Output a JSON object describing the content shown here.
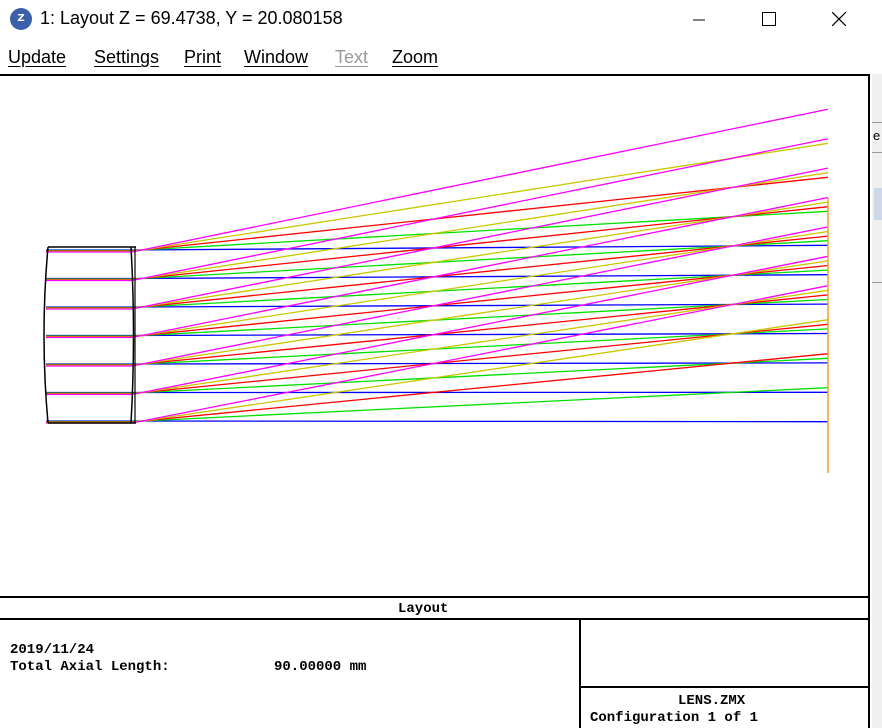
{
  "window": {
    "title": "1: Layout Z = 69.4738, Y = 20.080158",
    "icon": "zemax-app-icon",
    "controls": [
      "minimize-icon",
      "maximize-icon",
      "close-icon"
    ]
  },
  "menu": {
    "items": [
      {
        "label": "Update",
        "enabled": true
      },
      {
        "label": "Settings",
        "enabled": true
      },
      {
        "label": "Print",
        "enabled": true
      },
      {
        "label": "Window",
        "enabled": true
      },
      {
        "label": "Text",
        "enabled": false
      },
      {
        "label": "Zoom",
        "enabled": true
      }
    ]
  },
  "side_panel": {
    "visible_char": "e"
  },
  "footer": {
    "title": "Layout",
    "date": "2019/11/24",
    "total_axial_length_label": "Total Axial Length:",
    "total_axial_length_value": "90.00000 mm",
    "file_name": "LENS.ZMX",
    "configuration": "Configuration 1 of 1"
  },
  "colors": {
    "ray_colors": [
      "#0000ff",
      "#00e000",
      "#ff0000",
      "#c8c800",
      "#ff00ff"
    ],
    "image_plane": "#f0a030",
    "lens": "#000000"
  }
}
